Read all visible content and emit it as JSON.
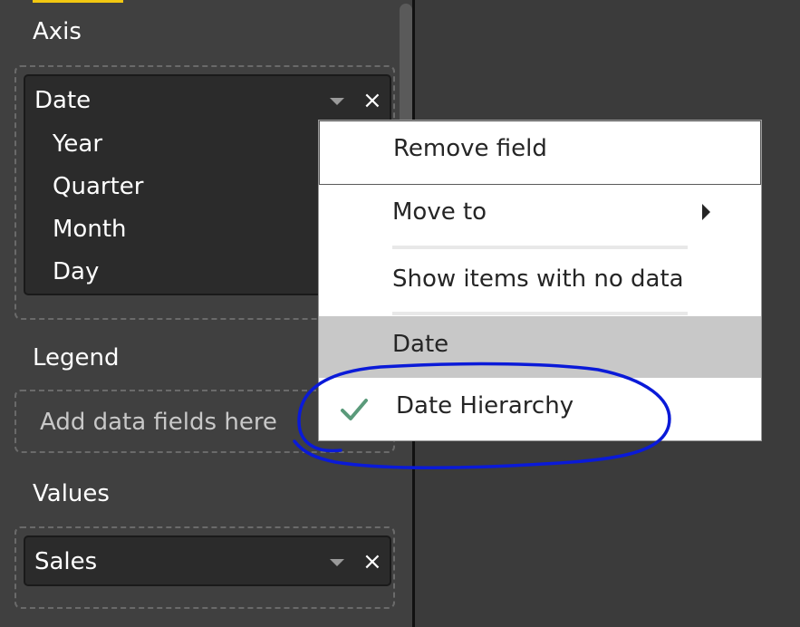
{
  "fields_pane": {
    "axis": {
      "label": "Axis",
      "field": {
        "name": "Date",
        "hierarchy": [
          "Year",
          "Quarter",
          "Month",
          "Day"
        ]
      }
    },
    "legend": {
      "label": "Legend",
      "placeholder": "Add data fields here"
    },
    "values": {
      "label": "Values",
      "field": {
        "name": "Sales"
      }
    }
  },
  "context_menu": {
    "remove_field": "Remove field",
    "move_to": "Move to",
    "show_items_no_data": "Show items with no data",
    "date": "Date",
    "date_hierarchy": "Date Hierarchy"
  },
  "icons": {
    "remove": "×",
    "dropdown": "chevron-down-icon",
    "check": "check-icon",
    "submenu": "caret-right-icon"
  },
  "colors": {
    "pane_bg": "#404040",
    "field_card_bg": "#2b2b2b",
    "menu_highlight": "#c8c8c8",
    "check_color": "#5a9a7a",
    "annotation_ink": "#0a1ad8",
    "accent": "#f2c811"
  }
}
